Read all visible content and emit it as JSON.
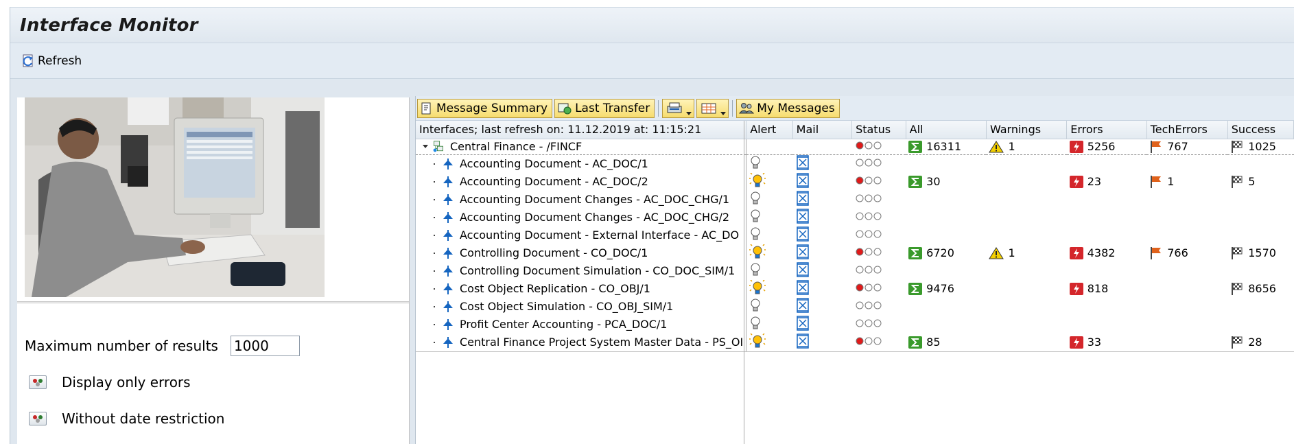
{
  "app": {
    "title": "Interface Monitor",
    "toolbar": {
      "refresh_label": "Refresh"
    }
  },
  "params": {
    "max_results_label": "Maximum number of results",
    "max_results_value": "1000",
    "only_errors_label": "Display only errors",
    "no_date_label": "Without date restriction"
  },
  "alv_toolbar": {
    "message_summary": "Message Summary",
    "last_transfer": "Last Transfer",
    "my_messages": "My Messages"
  },
  "grid": {
    "columns": {
      "name": "Interfaces; last refresh on: 11.12.2019 at: 11:15:21",
      "alert": "Alert",
      "mail": "Mail",
      "status": "Status",
      "all": "All",
      "warnings": "Warnings",
      "errors": "Errors",
      "tech_errors": "TechErrors",
      "success": "Success"
    },
    "root": {
      "name": "Central Finance - /FINCF",
      "status": "red",
      "all": "16311",
      "warnings": "1",
      "errors": "5256",
      "tech_errors": "767",
      "success": "1025"
    },
    "rows": [
      {
        "name": "Accounting Document - AC_DOC/1",
        "alert": "off",
        "status": "none",
        "all": "",
        "warnings": "",
        "errors": "",
        "tech_errors": "",
        "success": ""
      },
      {
        "name": "Accounting Document - AC_DOC/2",
        "alert": "on",
        "status": "red",
        "all": "30",
        "warnings": "",
        "errors": "23",
        "tech_errors": "1",
        "success": "5"
      },
      {
        "name": "Accounting Document Changes - AC_DOC_CHG/1",
        "alert": "off",
        "status": "none",
        "all": "",
        "warnings": "",
        "errors": "",
        "tech_errors": "",
        "success": ""
      },
      {
        "name": "Accounting Document Changes - AC_DOC_CHG/2",
        "alert": "off",
        "status": "none",
        "all": "",
        "warnings": "",
        "errors": "",
        "tech_errors": "",
        "success": ""
      },
      {
        "name": "Accounting Document - External Interface - AC_DO",
        "alert": "off",
        "status": "none",
        "all": "",
        "warnings": "",
        "errors": "",
        "tech_errors": "",
        "success": ""
      },
      {
        "name": "Controlling Document - CO_DOC/1",
        "alert": "on",
        "status": "red",
        "all": "6720",
        "warnings": "1",
        "errors": "4382",
        "tech_errors": "766",
        "success": "1570"
      },
      {
        "name": "Controlling Document Simulation - CO_DOC_SIM/1",
        "alert": "off",
        "status": "none",
        "all": "",
        "warnings": "",
        "errors": "",
        "tech_errors": "",
        "success": ""
      },
      {
        "name": "Cost Object Replication - CO_OBJ/1",
        "alert": "on",
        "status": "red",
        "all": "9476",
        "warnings": "",
        "errors": "818",
        "tech_errors": "",
        "success": "8656"
      },
      {
        "name": "Cost Object Simulation - CO_OBJ_SIM/1",
        "alert": "off",
        "status": "none",
        "all": "",
        "warnings": "",
        "errors": "",
        "tech_errors": "",
        "success": ""
      },
      {
        "name": "Profit Center Accounting - PCA_DOC/1",
        "alert": "off",
        "status": "none",
        "all": "",
        "warnings": "",
        "errors": "",
        "tech_errors": "",
        "success": ""
      },
      {
        "name": "Central Finance Project System Master Data - PS_OI",
        "alert": "on",
        "status": "red",
        "all": "85",
        "warnings": "",
        "errors": "33",
        "tech_errors": "",
        "success": "28"
      }
    ]
  },
  "colors": {
    "sum_green": "#3a9a2c",
    "error_red": "#d4262b",
    "flag_orange": "#e0621c",
    "warn_yellow": "#f4d000",
    "status_red": "#e01a1a",
    "frame_bg": "#dfe8f1",
    "button_yellow": "#f6dc6e"
  }
}
